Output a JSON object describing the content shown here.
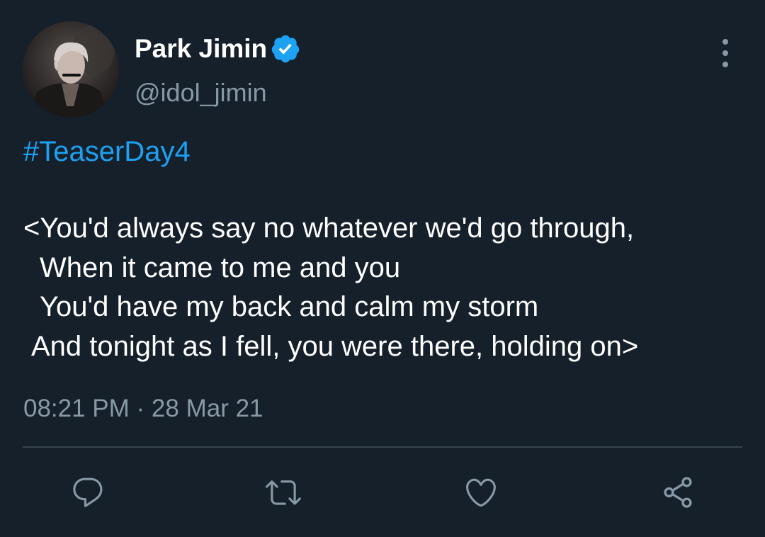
{
  "tweet": {
    "display_name": "Park Jimin",
    "handle": "@idol_jimin",
    "hashtag": "#TeaserDay4",
    "lines": [
      "<You'd always say no whatever we'd go through,",
      "When it came to me and you",
      "You'd have my back and calm my storm",
      "And tonight as I fell, you were there, holding on>"
    ],
    "timestamp": "08:21 PM · 28 Mar 21"
  },
  "icons": {
    "verified": "verified-badge-icon",
    "more": "more-vertical-icon",
    "reply": "reply-icon",
    "retweet": "retweet-icon",
    "like": "heart-icon",
    "share": "share-icon"
  },
  "colors": {
    "background": "#15202b",
    "text": "#ffffff",
    "secondary": "#8899a6",
    "accent": "#1da1f2",
    "divider": "#38444d"
  }
}
